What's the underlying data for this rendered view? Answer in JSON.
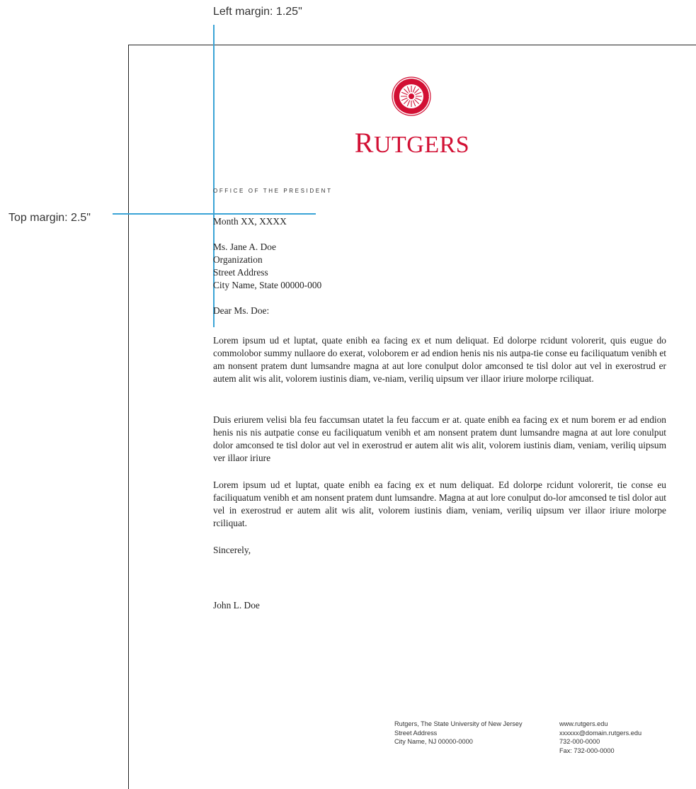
{
  "annotations": {
    "left_margin": "Left margin: 1.25\"",
    "top_margin": "Top margin: 2.5\""
  },
  "letterhead": {
    "wordmark": "Rutgers",
    "office": "OFFICE OF THE PRESIDENT",
    "brand_color": "#d21034",
    "seal_icon": "rutgers-seal-icon"
  },
  "letter": {
    "date": "Month XX, XXXX",
    "recipient": {
      "name": "Ms. Jane A. Doe",
      "organization": "Organization",
      "street": "Street Address",
      "city": "City Name, State 00000-000"
    },
    "salutation": "Dear Ms. Doe:",
    "paragraphs": [
      "Lorem ipsum ud et luptat, quate enibh ea facing ex et num deliquat. Ed dolorpe rcidunt volorerit, quis eugue do commolobor summy nullaore do exerat, voloborem er ad endion henis nis nis autpa-tie conse eu faciliquatum venibh et am nonsent pratem dunt lumsandre magna at aut lore conulput dolor amconsed te tisl dolor aut vel in exerostrud er autem alit wis alit, volorem iustinis diam, ve-niam, veriliq uipsum ver illaor iriure molorpe rciliquat.",
      "Duis eriurem velisi bla feu faccumsan utatet la feu faccum er at. quate enibh ea facing ex et num borem er ad endion henis nis nis autpatie conse eu faciliquatum venibh et am nonsent pratem dunt lumsandre magna at aut lore conulput dolor amconsed te tisl dolor aut vel in exerostrud er autem alit wis alit, volorem iustinis diam, veniam, veriliq uipsum ver illaor iriure",
      "Lorem ipsum ud et luptat, quate enibh ea facing ex et num deliquat. Ed dolorpe rcidunt volorerit, tie conse eu faciliquatum venibh et am nonsent pratem dunt lumsandre. Magna at aut lore conulput do-lor amconsed te tisl dolor aut vel in exerostrud er autem alit wis alit, volorem iustinis diam, veniam, veriliq uipsum ver illaor iriure molorpe rciliquat."
    ],
    "closing": "Sincerely,",
    "signer": "John L. Doe"
  },
  "footer": {
    "left": [
      "Rutgers, The State University of New Jersey",
      "Street Address",
      "City Name, NJ 00000-0000"
    ],
    "right": [
      "www.rutgers.edu",
      "xxxxxx@domain.rutgers.edu",
      "732-000-0000",
      "Fax: 732-000-0000"
    ]
  },
  "guides": {
    "color": "#3aa3d6"
  }
}
